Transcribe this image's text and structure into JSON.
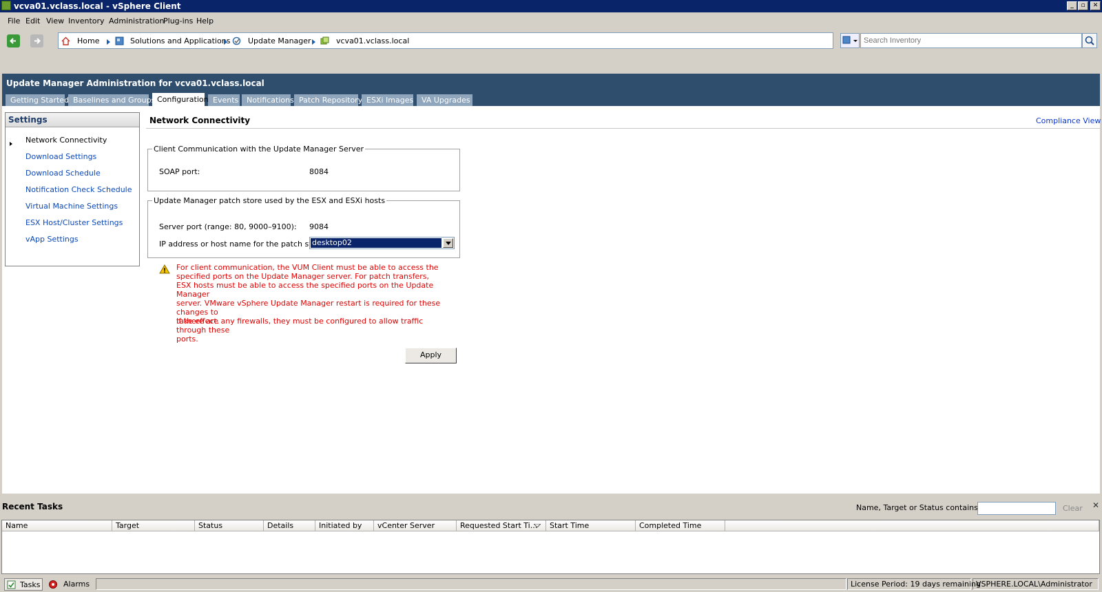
{
  "window": {
    "title": "vcva01.vclass.local - vSphere Client",
    "min_glyph": "_",
    "max_glyph": "▫",
    "close_glyph": "✕"
  },
  "menu": [
    "File",
    "Edit",
    "View",
    "Inventory",
    "Administration",
    "Plug-ins",
    "Help"
  ],
  "breadcrumb": {
    "home": "Home",
    "solutions": "Solutions and Applications",
    "update_manager": "Update Manager",
    "server": "vcva01.vclass.local"
  },
  "search": {
    "placeholder": "Search Inventory"
  },
  "admin": {
    "title": "Update Manager Administration for vcva01.vclass.local",
    "tabs": [
      "Getting Started",
      "Baselines and Groups",
      "Configuration",
      "Events",
      "Notifications",
      "Patch Repository",
      "ESXi Images",
      "VA Upgrades"
    ],
    "active_tab": "Configuration"
  },
  "settings": {
    "header": "Settings",
    "items": [
      "Network Connectivity",
      "Download Settings",
      "Download Schedule",
      "Notification Check Schedule",
      "Virtual Machine Settings",
      "ESX Host/Cluster Settings",
      "vApp Settings"
    ]
  },
  "content": {
    "title": "Network Connectivity",
    "compliance_link": "Compliance View",
    "group1": {
      "legend": "Client Communication with the Update Manager Server",
      "soap_label": "SOAP port:",
      "soap_value": "8084"
    },
    "group2": {
      "legend": "Update Manager patch store used by the ESX and ESXi hosts",
      "server_port_label": "Server port (range: 80, 9000–9100):",
      "server_port_value": "9084",
      "ip_label": "IP address or host name for the patch store:",
      "ip_value": "desktop02"
    },
    "warning_lines": [
      "For client communication, the VUM Client must be able to access the",
      "specified ports on the Update Manager server. For patch transfers,",
      "ESX hosts must be able to access the specified ports on the Update Manager",
      "server. VMware vSphere Update Manager restart is required for these changes to",
      "take effect."
    ],
    "firewall_lines": [
      "If there are any firewalls, they must be configured to allow traffic through these",
      "ports."
    ],
    "apply_label": "Apply"
  },
  "tasks": {
    "title": "Recent Tasks",
    "filter_label": "Name, Target or Status contains: ▾",
    "clear_label": "Clear",
    "close_glyph": "✕",
    "columns": [
      "Name",
      "Target",
      "Status",
      "Details",
      "Initiated by",
      "vCenter Server",
      "Requested Start Ti...",
      "Start Time",
      "Completed Time"
    ]
  },
  "statusbar": {
    "tasks": "Tasks",
    "alarms": "Alarms",
    "license": "License Period: 19 days remaining",
    "user": "VSPHERE.LOCAL\\Administrator"
  },
  "colors": {
    "title_bar": "#0a246a",
    "admin_header": "#2f4e6e",
    "link": "#0b47b8",
    "warning": "#e00000"
  }
}
